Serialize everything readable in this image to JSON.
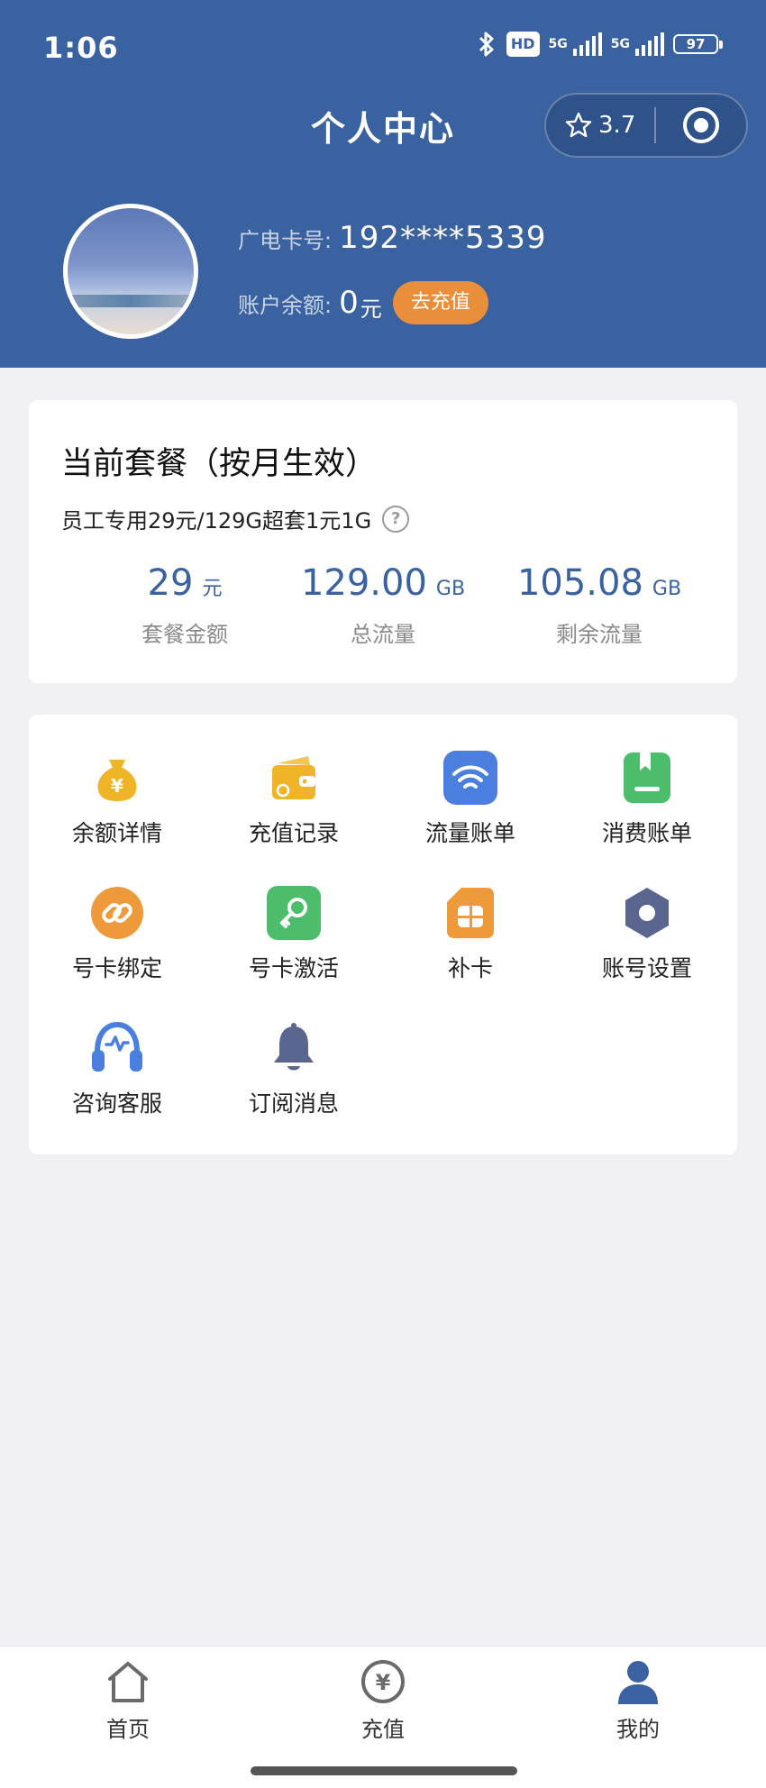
{
  "status_bar": {
    "time": "1:06",
    "hd": "HD",
    "net1": "5G",
    "net2": "5G",
    "battery": "97"
  },
  "header": {
    "title": "个人中心",
    "capsule": {
      "rating": "3.7"
    },
    "card_label": "广电卡号:",
    "card_number": "192****5339",
    "balance_label": "账户余额:",
    "balance_value": "0",
    "balance_unit": "元",
    "recharge_button": "去充值"
  },
  "plan": {
    "title": "当前套餐（按月生效）",
    "description": "员工专用29元/129G超套1元1G",
    "stats": [
      {
        "value": "29",
        "unit": "元",
        "label": "套餐金额"
      },
      {
        "value": "129.00",
        "unit": "GB",
        "label": "总流量"
      },
      {
        "value": "105.08",
        "unit": "GB",
        "label": "剩余流量"
      }
    ]
  },
  "menu": [
    {
      "label": "余额详情",
      "icon": "money-bag-icon",
      "color": "#f0b429"
    },
    {
      "label": "充值记录",
      "icon": "wallet-icon",
      "color": "#f0b429"
    },
    {
      "label": "流量账单",
      "icon": "wifi-icon",
      "color": "#4a7fe0"
    },
    {
      "label": "消费账单",
      "icon": "bookmark-icon",
      "color": "#4cbd6a"
    },
    {
      "label": "号卡绑定",
      "icon": "link-icon",
      "color": "#ef9a3a"
    },
    {
      "label": "号卡激活",
      "icon": "key-icon",
      "color": "#4cbd6a"
    },
    {
      "label": "补卡",
      "icon": "sim-card-icon",
      "color": "#ef9a3a"
    },
    {
      "label": "账号设置",
      "icon": "settings-hexagon-icon",
      "color": "#5a6590"
    },
    {
      "label": "咨询客服",
      "icon": "headset-icon",
      "color": "#4a7fe0"
    },
    {
      "label": "订阅消息",
      "icon": "bell-icon",
      "color": "#5a6590"
    }
  ],
  "tabbar": {
    "items": [
      {
        "label": "首页",
        "icon": "home-icon"
      },
      {
        "label": "充值",
        "icon": "yen-coin-icon"
      },
      {
        "label": "我的",
        "icon": "user-icon",
        "active": true
      }
    ]
  },
  "colors": {
    "primary": "#3a62a0",
    "accent": "#e98e3b",
    "background": "#f0f0f5"
  }
}
